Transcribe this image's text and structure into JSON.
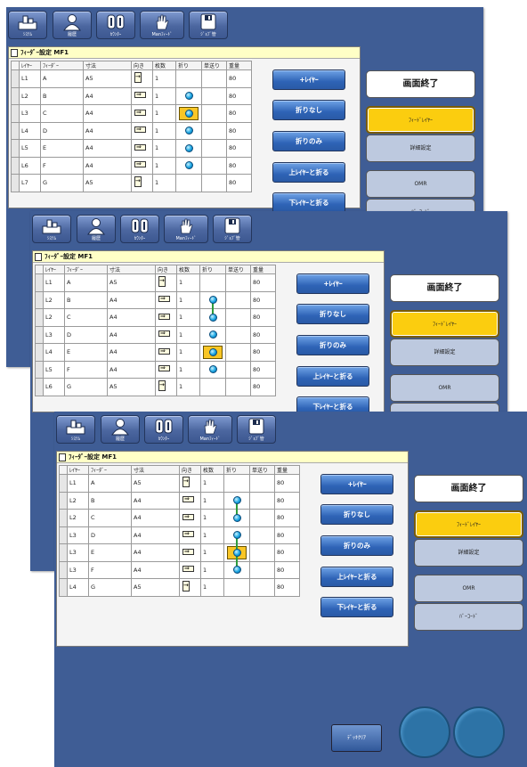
{
  "toolbar": [
    {
      "id": "system",
      "label": "ｼｽﾃﾑ",
      "icon": "system-icon"
    },
    {
      "id": "history",
      "label": "履歴",
      "icon": "user-icon"
    },
    {
      "id": "counter",
      "label": "ｶｳﾝﾀｰ",
      "icon": "counter-icon"
    },
    {
      "id": "manual",
      "label": "Manﾌｨｰﾄﾞ",
      "icon": "hand-icon"
    },
    {
      "id": "job",
      "label": "ｼﾞｮﾌﾞ管",
      "icon": "disk-icon"
    }
  ],
  "panel_title": "ﾌｨｰﾀﾞｰ設定 MF1",
  "columns": [
    "ﾚｲﾔｰ",
    "ﾌｨｰﾀﾞｰ",
    "寸法",
    "向き",
    "枚数",
    "折り",
    "単送り",
    "重量"
  ],
  "op_buttons": [
    "+ﾚｲﾔｰ",
    "折りなし",
    "折りのみ",
    "上ﾚｲﾔｰと折る",
    "下ﾚｲﾔｰと折る"
  ],
  "right_buttons": [
    "画面終了",
    "ﾌｨｰﾄﾞﾚｲﾔｰ",
    "詳細設定",
    "OMR",
    "ﾊﾞｰｺｰﾄﾞ"
  ],
  "clear_button": "ﾃﾞｯｷｸﾘｱ",
  "colors": {
    "background": "#3f5d95",
    "active": "#fbcd0f",
    "button": "#2e63b6",
    "fold_dot": "#19a6e3"
  },
  "screens": [
    {
      "rows": [
        {
          "layer": "L1",
          "feeder": "A",
          "size": "A5",
          "ori": "portrait",
          "count": "1",
          "fold": "none",
          "weight": "80"
        },
        {
          "layer": "L2",
          "feeder": "B",
          "size": "A4",
          "ori": "landscape",
          "count": "1",
          "fold": "dot",
          "weight": "80"
        },
        {
          "layer": "L3",
          "feeder": "C",
          "size": "A4",
          "ori": "landscape",
          "count": "1",
          "fold": "selected",
          "weight": "80"
        },
        {
          "layer": "L4",
          "feeder": "D",
          "size": "A4",
          "ori": "landscape",
          "count": "1",
          "fold": "dot",
          "weight": "80"
        },
        {
          "layer": "L5",
          "feeder": "E",
          "size": "A4",
          "ori": "landscape",
          "count": "1",
          "fold": "dot",
          "weight": "80"
        },
        {
          "layer": "L6",
          "feeder": "F",
          "size": "A4",
          "ori": "landscape",
          "count": "1",
          "fold": "dot",
          "weight": "80"
        },
        {
          "layer": "L7",
          "feeder": "G",
          "size": "A5",
          "ori": "portrait",
          "count": "1",
          "fold": "none",
          "weight": "80"
        }
      ]
    },
    {
      "rows": [
        {
          "layer": "L1",
          "feeder": "A",
          "size": "A5",
          "ori": "portrait",
          "count": "1",
          "fold": "none",
          "weight": "80"
        },
        {
          "layer": "L2",
          "feeder": "B",
          "size": "A4",
          "ori": "landscape",
          "count": "1",
          "fold": "link-top",
          "weight": "80"
        },
        {
          "layer": "L2",
          "feeder": "C",
          "size": "A4",
          "ori": "landscape",
          "count": "1",
          "fold": "link-bottom",
          "weight": "80"
        },
        {
          "layer": "L3",
          "feeder": "D",
          "size": "A4",
          "ori": "landscape",
          "count": "1",
          "fold": "dot",
          "weight": "80"
        },
        {
          "layer": "L4",
          "feeder": "E",
          "size": "A4",
          "ori": "landscape",
          "count": "1",
          "fold": "selected",
          "weight": "80"
        },
        {
          "layer": "L5",
          "feeder": "F",
          "size": "A4",
          "ori": "landscape",
          "count": "1",
          "fold": "dot",
          "weight": "80"
        },
        {
          "layer": "L6",
          "feeder": "G",
          "size": "A5",
          "ori": "portrait",
          "count": "1",
          "fold": "none",
          "weight": "80"
        }
      ]
    },
    {
      "rows": [
        {
          "layer": "L1",
          "feeder": "A",
          "size": "A5",
          "ori": "portrait",
          "count": "1",
          "fold": "none",
          "weight": "80"
        },
        {
          "layer": "L2",
          "feeder": "B",
          "size": "A4",
          "ori": "landscape",
          "count": "1",
          "fold": "link-top",
          "weight": "80"
        },
        {
          "layer": "L2",
          "feeder": "C",
          "size": "A4",
          "ori": "landscape",
          "count": "1",
          "fold": "link-bottom",
          "weight": "80"
        },
        {
          "layer": "L3",
          "feeder": "D",
          "size": "A4",
          "ori": "landscape",
          "count": "1",
          "fold": "link-top",
          "weight": "80"
        },
        {
          "layer": "L3",
          "feeder": "E",
          "size": "A4",
          "ori": "landscape",
          "count": "1",
          "fold": "link-mid-selected",
          "weight": "80"
        },
        {
          "layer": "L3",
          "feeder": "F",
          "size": "A4",
          "ori": "landscape",
          "count": "1",
          "fold": "link-bottom",
          "weight": "80"
        },
        {
          "layer": "L4",
          "feeder": "G",
          "size": "A5",
          "ori": "portrait",
          "count": "1",
          "fold": "none",
          "weight": "80"
        }
      ]
    }
  ]
}
